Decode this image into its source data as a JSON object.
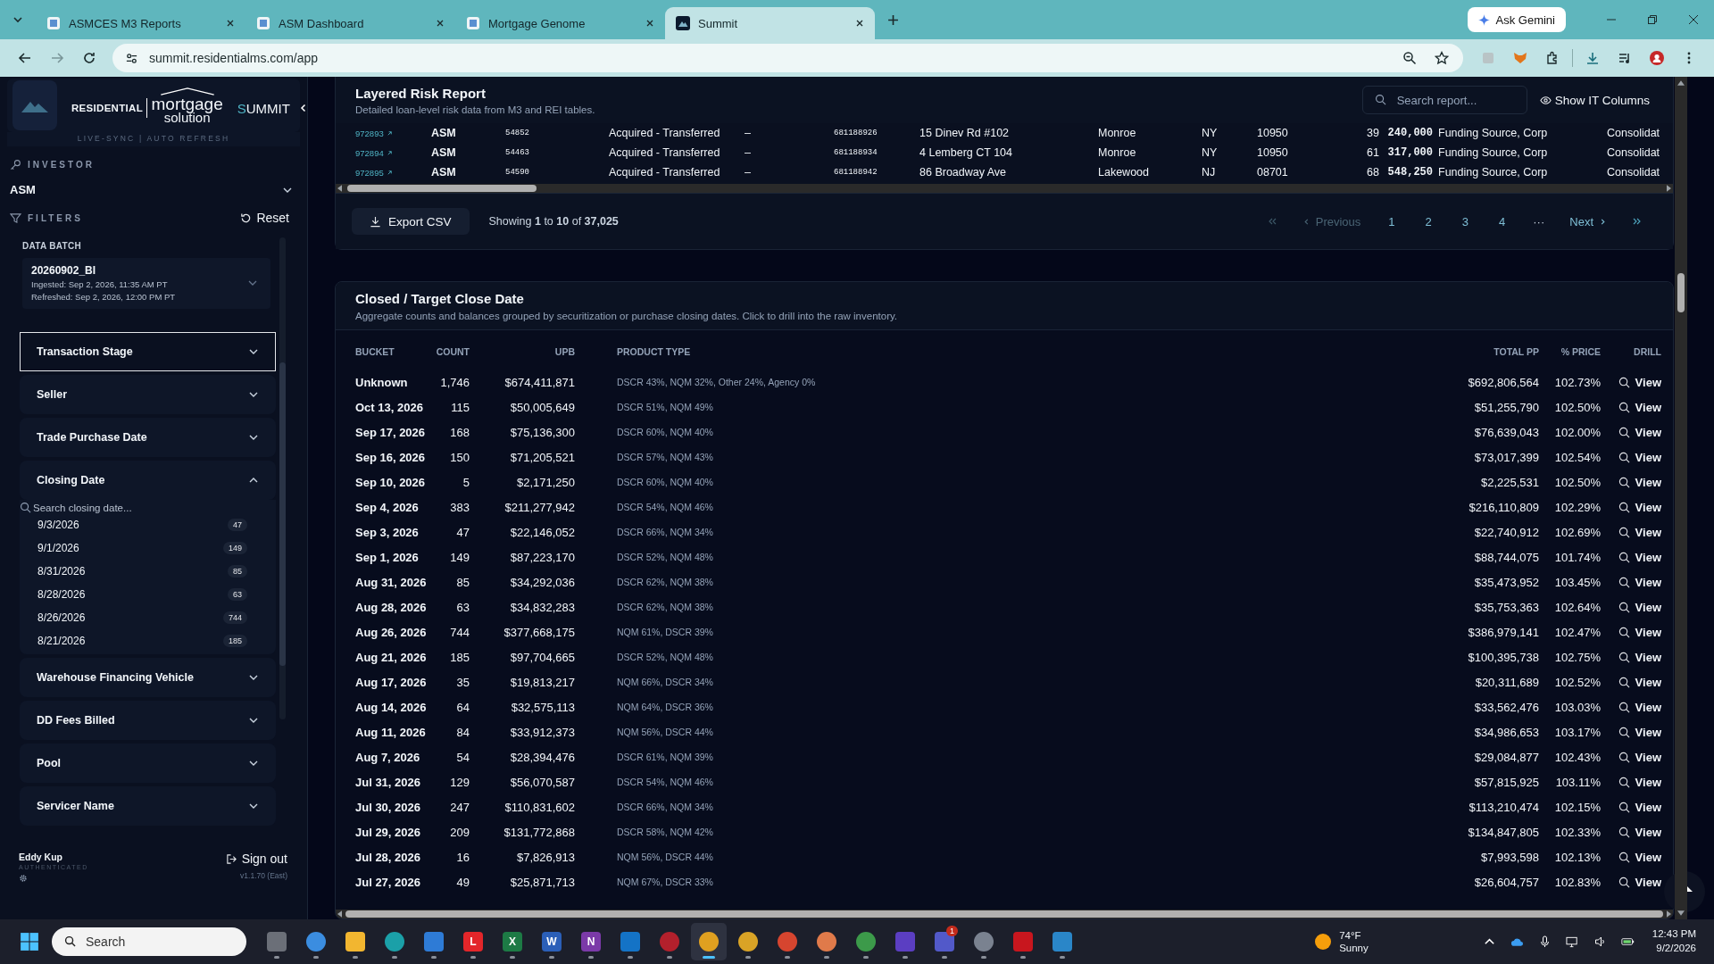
{
  "browser": {
    "tabs": [
      {
        "title": "ASMCES M3 Reports",
        "selected": false
      },
      {
        "title": "ASM Dashboard",
        "selected": false
      },
      {
        "title": "Mortgage Genome",
        "selected": false
      },
      {
        "title": "Summit",
        "selected": true
      }
    ],
    "gemini": "Ask Gemini",
    "url": "summit.residentialms.com/app"
  },
  "sidebar": {
    "brand_left": "RESIDENTIAL",
    "brand_word": "mortgage",
    "brand_sub": "solution",
    "product": "SUMMIT",
    "sync": "LIVE-SYNC | AUTO REFRESH",
    "investor_label": "INVESTOR",
    "investor": "ASM",
    "filters_label": "FILTERS",
    "reset": "Reset",
    "batch_label": "DATA BATCH",
    "batch": {
      "name": "20260902_BI",
      "ingested": "Ingested: Sep 2, 2026, 11:35 AM PT",
      "refreshed": "Refreshed: Sep 2, 2026, 12:00 PM PT"
    },
    "filters": [
      {
        "label": "Transaction Stage",
        "expanded": false,
        "focused": true
      },
      {
        "label": "Seller",
        "expanded": false,
        "focused": false
      },
      {
        "label": "Trade Purchase Date",
        "expanded": false,
        "focused": false
      },
      {
        "label": "Closing Date",
        "expanded": true,
        "focused": false,
        "search_placeholder": "Search closing date...",
        "options": [
          {
            "label": "9/3/2026",
            "count": "47"
          },
          {
            "label": "9/1/2026",
            "count": "149"
          },
          {
            "label": "8/31/2026",
            "count": "85"
          },
          {
            "label": "8/28/2026",
            "count": "63"
          },
          {
            "label": "8/26/2026",
            "count": "744"
          },
          {
            "label": "8/21/2026",
            "count": "185"
          }
        ]
      },
      {
        "label": "Warehouse Financing Vehicle",
        "expanded": false,
        "focused": false
      },
      {
        "label": "DD Fees Billed",
        "expanded": false,
        "focused": false
      },
      {
        "label": "Pool",
        "expanded": false,
        "focused": false
      },
      {
        "label": "Servicer Name",
        "expanded": false,
        "focused": false
      }
    ],
    "user": "Eddy Kup",
    "user_status": "AUTHENTICATED",
    "sign_out": "Sign out",
    "version": "v1.1.70 (East)"
  },
  "risk_report": {
    "title": "Layered Risk Report",
    "subtitle": "Detailed loan-level risk data from M3 and REI tables.",
    "search_placeholder": "Search report...",
    "it_columns": "Show IT Columns",
    "rows": [
      {
        "cells": [
          "972893",
          "ASM",
          "54852",
          "Acquired - Transferred",
          "–",
          "681188926",
          "15 Dinev Rd #102",
          "Monroe",
          "NY",
          "10950",
          "39",
          "240,000",
          "Funding Source, Corp",
          "Consolidat"
        ]
      },
      {
        "cells": [
          "972894",
          "ASM",
          "54463",
          "Acquired - Transferred",
          "–",
          "681188934",
          "4 Lemberg CT 104",
          "Monroe",
          "NY",
          "10950",
          "61",
          "317,000",
          "Funding Source, Corp",
          "Consolidat"
        ]
      },
      {
        "cells": [
          "972895",
          "ASM",
          "54590",
          "Acquired - Transferred",
          "–",
          "681188942",
          "86 Broadway Ave",
          "Lakewood",
          "NJ",
          "08701",
          "68",
          "548,250",
          "Funding Source, Corp",
          "Consolidat"
        ]
      }
    ],
    "export": "Export CSV",
    "showing": "Showing **1** to **10** of **37,025**",
    "pagination": {
      "first_disabled": true,
      "previous": "Previous",
      "previous_disabled": true,
      "pages": [
        "1",
        "2",
        "3",
        "4"
      ],
      "ellipsis": "···",
      "next": "Next"
    }
  },
  "close_report": {
    "title": "Closed / Target Close Date",
    "subtitle": "Aggregate counts and balances grouped by securitization or purchase closing dates. Click to drill into the raw inventory.",
    "columns": [
      "BUCKET",
      "COUNT",
      "UPB",
      "PRODUCT TYPE",
      "TOTAL PP",
      "% PRICE",
      "DRILL"
    ],
    "rows": [
      {
        "bucket": "Unknown",
        "count": "1,746",
        "upb": "$674,411,871",
        "product": "DSCR 43%, NQM 32%, Other 24%, Agency 0%",
        "total_pp": "$692,806,564",
        "price": "102.73%",
        "drill": "View"
      },
      {
        "bucket": "Oct 13, 2026",
        "count": "115",
        "upb": "$50,005,649",
        "product": "DSCR 51%, NQM 49%",
        "total_pp": "$51,255,790",
        "price": "102.50%",
        "drill": "View"
      },
      {
        "bucket": "Sep 17, 2026",
        "count": "168",
        "upb": "$75,136,300",
        "product": "DSCR 60%, NQM 40%",
        "total_pp": "$76,639,043",
        "price": "102.00%",
        "drill": "View"
      },
      {
        "bucket": "Sep 16, 2026",
        "count": "150",
        "upb": "$71,205,521",
        "product": "DSCR 57%, NQM 43%",
        "total_pp": "$73,017,399",
        "price": "102.54%",
        "drill": "View"
      },
      {
        "bucket": "Sep 10, 2026",
        "count": "5",
        "upb": "$2,171,250",
        "product": "DSCR 60%, NQM 40%",
        "total_pp": "$2,225,531",
        "price": "102.50%",
        "drill": "View"
      },
      {
        "bucket": "Sep 4, 2026",
        "count": "383",
        "upb": "$211,277,942",
        "product": "DSCR 54%, NQM 46%",
        "total_pp": "$216,110,809",
        "price": "102.29%",
        "drill": "View"
      },
      {
        "bucket": "Sep 3, 2026",
        "count": "47",
        "upb": "$22,146,052",
        "product": "DSCR 66%, NQM 34%",
        "total_pp": "$22,740,912",
        "price": "102.69%",
        "drill": "View"
      },
      {
        "bucket": "Sep 1, 2026",
        "count": "149",
        "upb": "$87,223,170",
        "product": "DSCR 52%, NQM 48%",
        "total_pp": "$88,744,075",
        "price": "101.74%",
        "drill": "View"
      },
      {
        "bucket": "Aug 31, 2026",
        "count": "85",
        "upb": "$34,292,036",
        "product": "DSCR 62%, NQM 38%",
        "total_pp": "$35,473,952",
        "price": "103.45%",
        "drill": "View"
      },
      {
        "bucket": "Aug 28, 2026",
        "count": "63",
        "upb": "$34,832,283",
        "product": "DSCR 62%, NQM 38%",
        "total_pp": "$35,753,363",
        "price": "102.64%",
        "drill": "View"
      },
      {
        "bucket": "Aug 26, 2026",
        "count": "744",
        "upb": "$377,668,175",
        "product": "NQM 61%, DSCR 39%",
        "total_pp": "$386,979,141",
        "price": "102.47%",
        "drill": "View"
      },
      {
        "bucket": "Aug 21, 2026",
        "count": "185",
        "upb": "$97,704,665",
        "product": "DSCR 52%, NQM 48%",
        "total_pp": "$100,395,738",
        "price": "102.75%",
        "drill": "View"
      },
      {
        "bucket": "Aug 17, 2026",
        "count": "35",
        "upb": "$19,813,217",
        "product": "NQM 66%, DSCR 34%",
        "total_pp": "$20,311,689",
        "price": "102.52%",
        "drill": "View"
      },
      {
        "bucket": "Aug 14, 2026",
        "count": "64",
        "upb": "$32,575,113",
        "product": "NQM 64%, DSCR 36%",
        "total_pp": "$33,562,476",
        "price": "103.03%",
        "drill": "View"
      },
      {
        "bucket": "Aug 11, 2026",
        "count": "84",
        "upb": "$33,912,373",
        "product": "NQM 56%, DSCR 44%",
        "total_pp": "$34,986,653",
        "price": "103.17%",
        "drill": "View"
      },
      {
        "bucket": "Aug 7, 2026",
        "count": "54",
        "upb": "$28,394,476",
        "product": "DSCR 61%, NQM 39%",
        "total_pp": "$29,084,877",
        "price": "102.43%",
        "drill": "View"
      },
      {
        "bucket": "Jul 31, 2026",
        "count": "129",
        "upb": "$56,070,587",
        "product": "DSCR 54%, NQM 46%",
        "total_pp": "$57,815,925",
        "price": "103.11%",
        "drill": "View"
      },
      {
        "bucket": "Jul 30, 2026",
        "count": "247",
        "upb": "$110,831,602",
        "product": "DSCR 66%, NQM 34%",
        "total_pp": "$113,210,474",
        "price": "102.15%",
        "drill": "View"
      },
      {
        "bucket": "Jul 29, 2026",
        "count": "209",
        "upb": "$131,772,868",
        "product": "DSCR 58%, NQM 42%",
        "total_pp": "$134,847,805",
        "price": "102.33%",
        "drill": "View"
      },
      {
        "bucket": "Jul 28, 2026",
        "count": "16",
        "upb": "$7,826,913",
        "product": "NQM 56%, DSCR 44%",
        "total_pp": "$7,993,598",
        "price": "102.13%",
        "drill": "View"
      },
      {
        "bucket": "Jul 27, 2026",
        "count": "49",
        "upb": "$25,871,713",
        "product": "NQM 67%, DSCR 33%",
        "total_pp": "$26,604,757",
        "price": "102.83%",
        "drill": "View"
      }
    ]
  },
  "taskbar": {
    "search": {
      "placeholder": "Search"
    },
    "apps": [
      {
        "kind": "square",
        "color": "#6b6f78",
        "selected": false
      },
      {
        "kind": "circle",
        "color": "#3b8de0",
        "selected": false
      },
      {
        "kind": "square",
        "color": "#f2b630",
        "selected": false
      },
      {
        "kind": "circle",
        "color": "#1ba0a8",
        "selected": false
      },
      {
        "kind": "square",
        "color": "#2e7bd6",
        "selected": false
      },
      {
        "kind": "square",
        "color": "#e3262a",
        "label": "L",
        "selected": false
      },
      {
        "kind": "square",
        "color": "#1d7a45",
        "label": "X",
        "selected": false
      },
      {
        "kind": "square",
        "color": "#2b5fb8",
        "label": "W",
        "selected": false
      },
      {
        "kind": "square",
        "color": "#7b3aa8",
        "label": "N",
        "selected": false
      },
      {
        "kind": "square",
        "color": "#1473c6",
        "selected": false
      },
      {
        "kind": "circle",
        "color": "#b3202c",
        "selected": false
      },
      {
        "kind": "circle",
        "color": "#e0a020",
        "selected": true
      },
      {
        "kind": "circle",
        "color": "#d9a326",
        "selected": false
      },
      {
        "kind": "circle",
        "color": "#d6452f",
        "selected": false
      },
      {
        "kind": "circle",
        "color": "#e07a4a",
        "selected": false
      },
      {
        "kind": "circle",
        "color": "#3c9a4a",
        "selected": false
      },
      {
        "kind": "square",
        "color": "#5b3ec2",
        "selected": false
      },
      {
        "kind": "square",
        "color": "#5259c9",
        "badge": "1",
        "selected": false
      },
      {
        "kind": "circle",
        "color": "#7a8290",
        "selected": false
      },
      {
        "kind": "square",
        "color": "#c8161e",
        "selected": false
      },
      {
        "kind": "square",
        "color": "#2a86c8",
        "selected": false
      }
    ],
    "weather": {
      "temp": "74°F",
      "condition": "Sunny"
    },
    "time": "12:43 PM",
    "date": "9/2/2026"
  }
}
